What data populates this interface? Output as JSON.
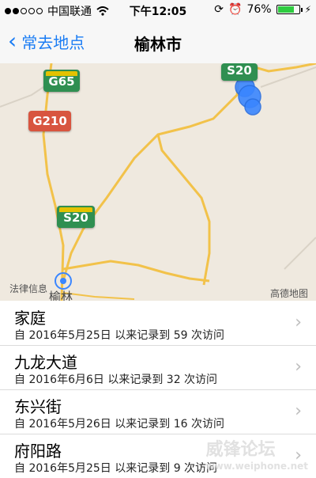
{
  "status_bar": {
    "carrier": "中国联通",
    "time": "下午12:05",
    "battery_percent": "76%",
    "signal_bars_filled": 2,
    "signal_bars_total": 5,
    "battery_fraction": 0.76,
    "battery_color": "#2ecc40"
  },
  "nav": {
    "back_label": "常去地点",
    "title": "榆林市",
    "accent_color": "#1a7cf4"
  },
  "map": {
    "shields": {
      "s20_top": "S20",
      "g65": "G65",
      "g210": "G210",
      "s20_mid": "S20"
    },
    "labels": {
      "legal_info": "法律信息",
      "city": "榆林",
      "attribution": "高德地图"
    },
    "colors": {
      "background": "#efe9df",
      "road": "#f2c24a",
      "pin": "#3a86ff"
    }
  },
  "places": [
    {
      "name": "家庭",
      "detail": "自 2016年5月25日 以来记录到 59 次访问"
    },
    {
      "name": "九龙大道",
      "detail": "自 2016年6月6日 以来记录到 32 次访问"
    },
    {
      "name": "东兴街",
      "detail": "自 2016年5月26日 以来记录到 16 次访问"
    },
    {
      "name": "府阳路",
      "detail": "自 2016年5月25日 以来记录到 9 次访问"
    }
  ],
  "watermark": {
    "text": "威锋论坛",
    "site": "www.weiphone.net"
  }
}
